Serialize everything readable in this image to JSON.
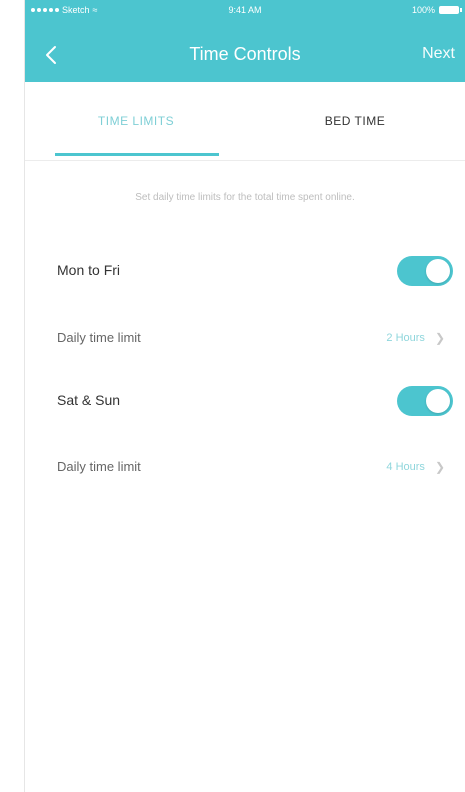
{
  "status_bar": {
    "carrier": "Sketch",
    "time": "9:41 AM",
    "battery": "100%"
  },
  "header": {
    "back_icon": "chevron-left-icon",
    "title": "Time Controls",
    "next_label": "Next"
  },
  "tabs": [
    {
      "label": "TIME LIMITS",
      "active": true
    },
    {
      "label": "BED TIME",
      "active": false
    }
  ],
  "description": "Set daily time limits for the total time spent online.",
  "settings": {
    "weekdays": {
      "label": "Mon to Fri",
      "enabled": true
    },
    "weekdays_limit": {
      "label": "Daily time limit",
      "value": "2 Hours"
    },
    "weekend": {
      "label": "Sat & Sun",
      "enabled": true
    },
    "weekend_limit": {
      "label": "Daily time limit",
      "value": "4 Hours"
    }
  },
  "colors": {
    "accent": "#4cc5cf",
    "header_text": "#ffffff",
    "active_tab_text": "#7fcfd6",
    "value_text": "#8fd6dc"
  }
}
